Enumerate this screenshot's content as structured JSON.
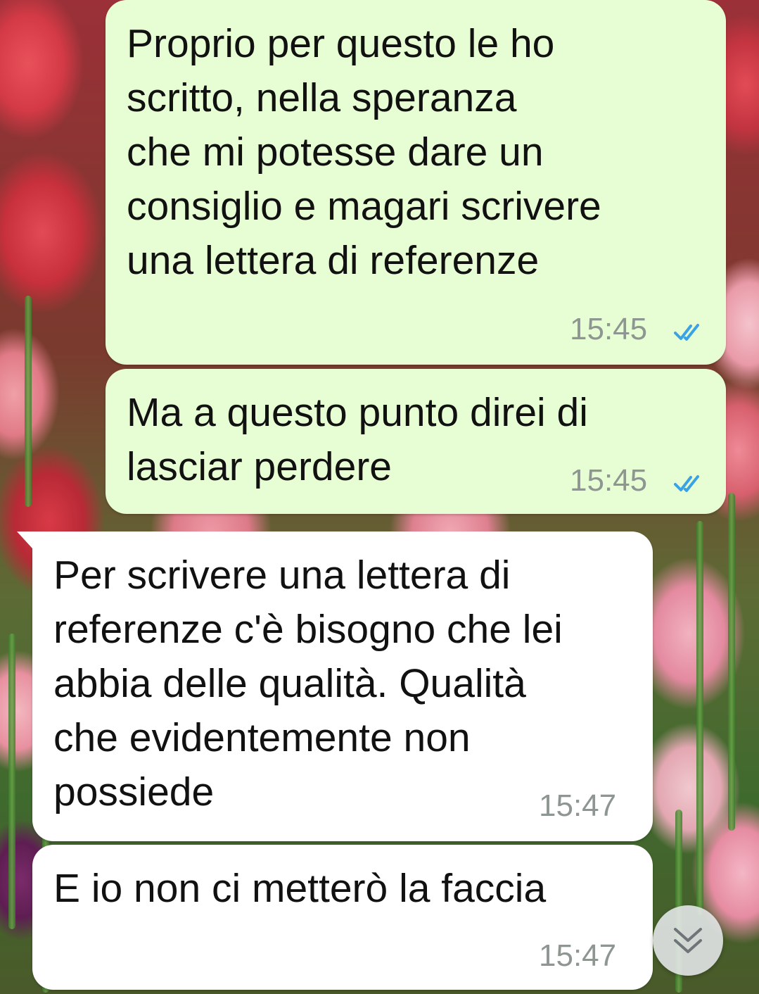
{
  "chat": {
    "messages": [
      {
        "direction": "outgoing",
        "text": "Proprio per questo le ho\nscritto, nella speranza\nche mi potesse dare un\nconsiglio e magari scrivere\nuna lettera di referenze",
        "time": "15:45",
        "status_icon": "double-check-read-icon"
      },
      {
        "direction": "outgoing",
        "text": "Ma a questo punto direi di\nlasciar perdere",
        "time": "15:45",
        "status_icon": "double-check-read-icon"
      },
      {
        "direction": "incoming",
        "text": "Per scrivere una lettera di\nreferenze c'è bisogno che lei\nabbia delle qualità. Qualità\nche evidentemente non\npossiede",
        "time": "15:47"
      },
      {
        "direction": "incoming",
        "text": "E io non ci metterò la faccia",
        "time": "15:47"
      }
    ],
    "scroll_down_icon": "double-chevron-down-icon"
  },
  "colors": {
    "outgoing_bubble": "#e7fdd3",
    "incoming_bubble": "#ffffff",
    "read_ticks": "#3aa3e3",
    "timestamp": "#8e9692"
  }
}
